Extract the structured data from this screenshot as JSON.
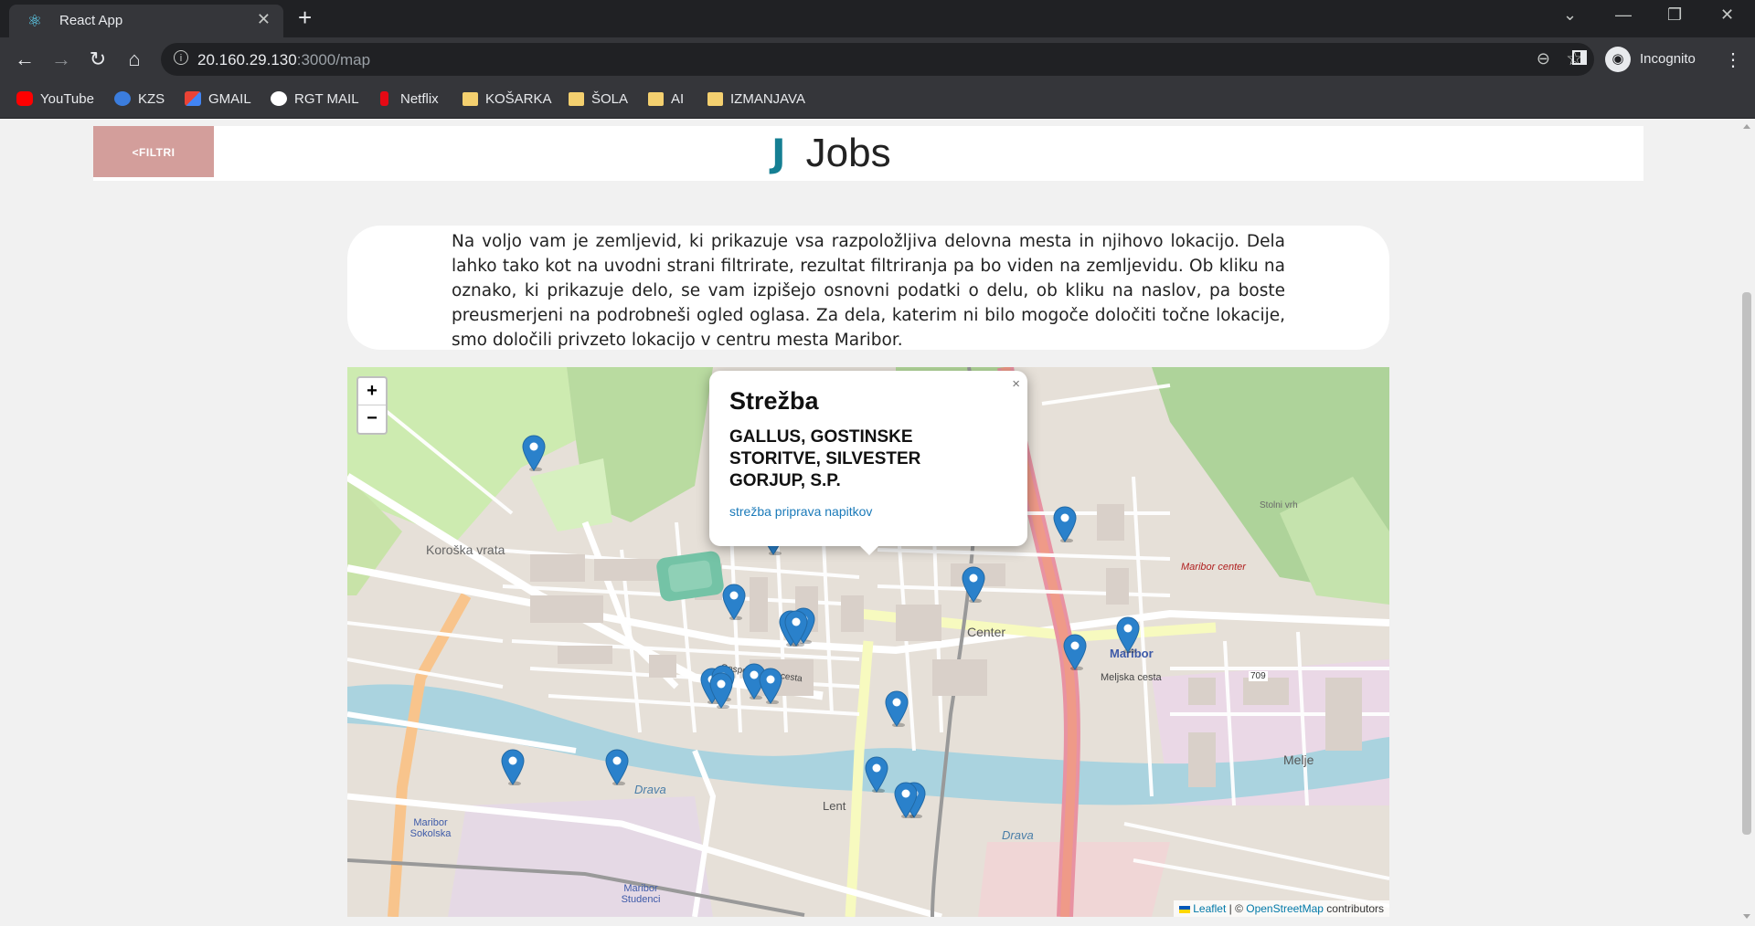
{
  "browser": {
    "tab_title": "React App",
    "url_host": "20.160.29.130",
    "url_path": ":3000/map",
    "profile_label": "Incognito",
    "bookmarks": [
      {
        "label": "YouTube",
        "icon": "youtube-icon"
      },
      {
        "label": "KZS",
        "icon": "kzs-icon"
      },
      {
        "label": "GMAIL",
        "icon": "gmail-icon"
      },
      {
        "label": "RGT MAIL",
        "icon": "google-icon"
      },
      {
        "label": "Netflix",
        "icon": "netflix-icon"
      },
      {
        "label": "KOŠARKA",
        "icon": "folder-icon"
      },
      {
        "label": "ŠOLA",
        "icon": "folder-icon"
      },
      {
        "label": "AI",
        "icon": "folder-icon"
      },
      {
        "label": "IZMANJAVA",
        "icon": "folder-icon"
      }
    ]
  },
  "header": {
    "filter_button": "<FILTRI",
    "logo_letter": "J",
    "logo_name": "Jobs",
    "accent_color": "#157f93",
    "filter_color": "#d39e9b"
  },
  "intro": {
    "text": "Na voljo vam je zemljevid, ki prikazuje vsa razpoložljiva delovna mesta in njihovo lokacijo. Dela lahko tako kot na uvodni strani filtrirate, rezultat filtriranja pa bo viden na zemljevidu. Ob kliku na oznako, ki prikazuje delo, se vam izpišejo osnovni podatki o delu, ob kliku na naslov, pa boste preusmerjeni na podrobneši ogled oglasa. Za dela, katerim ni bilo mogoče določiti točne lokacije, smo določili privzeto lokacijo v centru mesta Maribor."
  },
  "map": {
    "zoom_in": "+",
    "zoom_out": "−",
    "popup": {
      "title": "Strežba",
      "company": "GALLUS, GOSTINSKE STORITVE, SILVESTER GORJUP, S.P.",
      "tags": "strežba priprava napitkov",
      "close": "×"
    },
    "attribution": {
      "leaflet": "Leaflet",
      "separator": " | © ",
      "osm": "OpenStreetMap",
      "suffix": " contributors"
    },
    "labels": {
      "koroska": "Koroška vrata",
      "center": "Center",
      "lent": "Lent",
      "melje": "Melje",
      "drava1": "Drava",
      "drava2": "Drava",
      "maribor": "Maribor",
      "maribor_center": "Maribor center",
      "sokolska": "Maribor Sokolska",
      "studenci": "Maribor Studenci",
      "stolni_vrh": "Stolni vrh",
      "melja_cesta": "Meljska cesta",
      "gosposvetska": "Gosposvetska cesta",
      "road_709": "709"
    },
    "marker_color": "#2a81cb",
    "marker_count": 21
  }
}
